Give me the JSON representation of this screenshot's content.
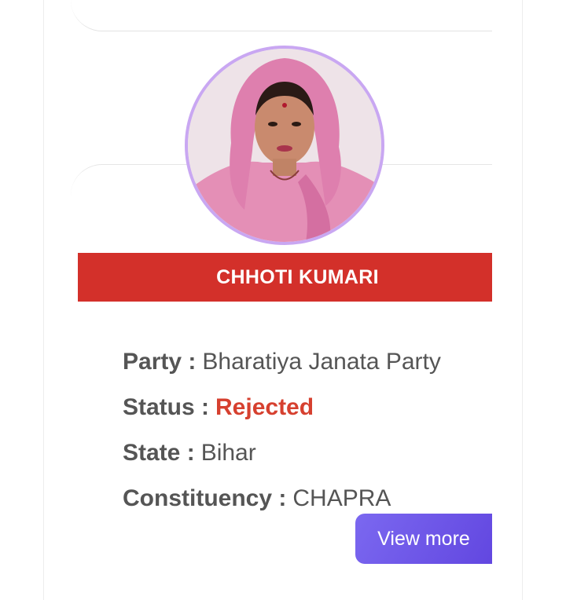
{
  "candidate": {
    "name": "CHHOTI KUMARI",
    "photo_alt": "candidate photo"
  },
  "details": [
    {
      "label": "Party :",
      "value": "Bharatiya Janata Party",
      "highlight": false
    },
    {
      "label": "Status :",
      "value": "Rejected",
      "highlight": true
    },
    {
      "label": "State :",
      "value": "Bihar",
      "highlight": false
    },
    {
      "label": "Constituency :",
      "value": "CHAPRA",
      "highlight": false
    }
  ],
  "actions": {
    "view_more_label": "View more"
  },
  "colors": {
    "banner": "#d3302a",
    "status_rejected": "#d6402f",
    "button_gradient_start": "#7b68f0",
    "button_gradient_end": "#6247e0",
    "avatar_border": "#c9a7f2"
  }
}
